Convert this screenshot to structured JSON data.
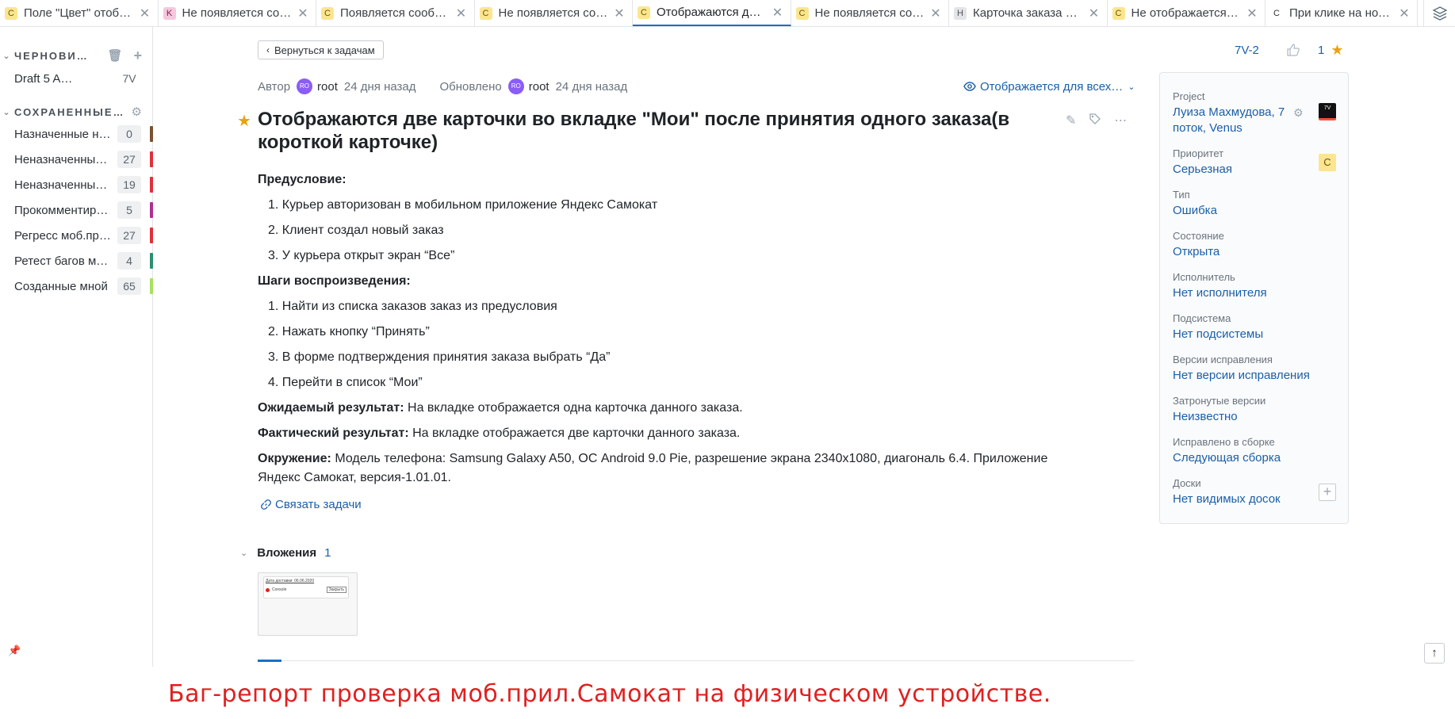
{
  "tabs": [
    {
      "badge": "C",
      "title": "Поле \"Цвет\" отоб…",
      "color": "y"
    },
    {
      "badge": "K",
      "title": "Не появляется со…",
      "color": "p"
    },
    {
      "badge": "C",
      "title": "Появляется сооб…",
      "color": "y"
    },
    {
      "badge": "C",
      "title": "Не появляется со…",
      "color": "y"
    },
    {
      "badge": "C",
      "title": "Отображаются дв…",
      "color": "y"
    },
    {
      "badge": "C",
      "title": "Не появляется со…",
      "color": "y"
    },
    {
      "badge": "H",
      "title": "Карточка заказа у…",
      "color": "g"
    },
    {
      "badge": "C",
      "title": "Не отображается …",
      "color": "y"
    },
    {
      "badge": "C",
      "title": "При клике на нот…",
      "color": "w"
    }
  ],
  "sidebar": {
    "drafts_header": "ЧЕРНОВИ…",
    "drafts": [
      {
        "name": "Draft 5 A…",
        "count": "7V"
      }
    ],
    "saved_header": "СОХРАНЕННЫЕ…",
    "saved": [
      {
        "name": "Назначенные н…",
        "count": "0",
        "color": "#7a5230"
      },
      {
        "name": "Неназначенны…",
        "count": "27",
        "color": "#e0303a"
      },
      {
        "name": "Неназначенны…",
        "count": "19",
        "color": "#e0303a"
      },
      {
        "name": "Прокомментир…",
        "count": "5",
        "color": "#b03090"
      },
      {
        "name": "Регресс моб.пр…",
        "count": "27",
        "color": "#e0303a"
      },
      {
        "name": "Ретест багов м…",
        "count": "4",
        "color": "#2a9070"
      },
      {
        "name": "Созданные мной",
        "count": "65",
        "color": "#a8e060"
      }
    ]
  },
  "issue": {
    "back_label": "Вернуться к задачам",
    "id": "7V-2",
    "likes": "1",
    "author_label": "Автор",
    "avatar_text": "RO",
    "author": "root",
    "created": "24 дня назад",
    "updated_label": "Обновлено",
    "updater": "root",
    "updated": "24 дня назад",
    "visibility": "Отображается для всех…",
    "title": "Отображаются две карточки во вкладке \"Мои\" после принятия одного заказа(в короткой карточке)",
    "precondition_label": "Предусловие:",
    "preconditions": [
      "1. Курьер авторизован в мобильном приложение Яндекс Самокат",
      "2. Клиент создал новый заказ",
      "3. У курьера открыт экран “Все”"
    ],
    "steps_label": "Шаги воспроизведения:",
    "steps": [
      "1. Найти из списка заказов заказ из предусловия",
      "2. Нажать кнопку “Принять”",
      "3. В форме подтверждения принятия заказа выбрать “Да”",
      "4. Перейти в список “Мои”"
    ],
    "expected_label": "Ожидаемый результат:",
    "expected": " На вкладке отображается одна карточка данного заказа.",
    "actual_label": "Фактический результат:",
    "actual": " На вкладке отображается две карточки данного заказа.",
    "env_label": "Окружение:",
    "env_line1": " Модель телефона: Samsung Galaxy A50, ОС Android 9.0 Pie, разрешение экрана 2340x1080, диагональ 6.4. Приложение",
    "env_line2": "Яндекс Самокат, версия-1.01.01.",
    "link_label": "Связать задачи",
    "attachments_label": "Вложения",
    "attachments_count": "1",
    "thumb_line1": "Дата доставки: 06.06.2020",
    "thumb_line2": "Console",
    "thumb_button": "Закрыть"
  },
  "fields": {
    "project_label": "Project",
    "project": "Луиза Махмудова, 7 поток, Venus",
    "project_badge": "7V",
    "priority_label": "Приоритет",
    "priority": "Серьезная",
    "priority_badge": "С",
    "type_label": "Тип",
    "type": "Ошибка",
    "state_label": "Состояние",
    "state": "Открыта",
    "assignee_label": "Исполнитель",
    "assignee": "Нет исполнителя",
    "subsystem_label": "Подсистема",
    "subsystem": "Нет подсистемы",
    "fix_versions_label": "Версии исправления",
    "fix_versions": "Нет версии исправления",
    "affected_label": "Затронутые версии",
    "affected": "Неизвестно",
    "fixed_build_label": "Исправлено в сборке",
    "fixed_build": "Следующая сборка",
    "boards_label": "Доски",
    "boards": "Нет видимых досок"
  },
  "caption": "Баг-репорт проверка моб.прил.Самокат на физическом устройстве."
}
